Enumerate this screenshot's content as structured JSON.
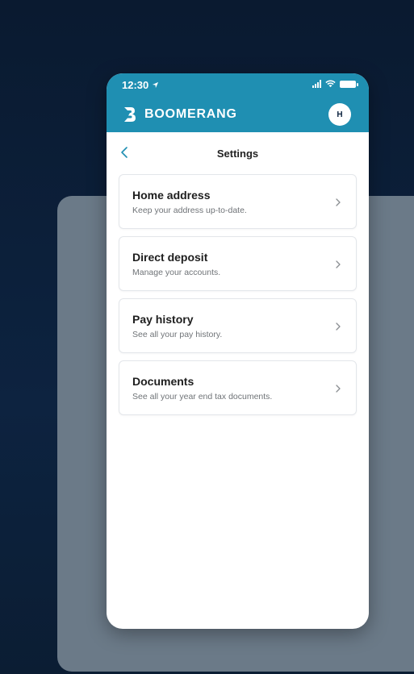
{
  "status": {
    "time": "12:30"
  },
  "appbar": {
    "brand": "BOOMERANG",
    "avatar_initial": "H"
  },
  "nav": {
    "title": "Settings"
  },
  "settings": [
    {
      "title": "Home address",
      "subtitle": "Keep your address up-to-date."
    },
    {
      "title": "Direct deposit",
      "subtitle": "Manage your accounts."
    },
    {
      "title": "Pay history",
      "subtitle": "See all your pay history."
    },
    {
      "title": "Documents",
      "subtitle": "See all your year end tax documents."
    }
  ],
  "colors": {
    "header": "#1f8fb2",
    "background": "#0d2340",
    "backdrop": "#6b7a88",
    "back_arrow": "#1f8fb2"
  },
  "icons": [
    "location-arrow-icon",
    "signal-icon",
    "wifi-icon",
    "battery-icon",
    "boomerang-logo-icon",
    "back-arrow-icon",
    "chevron-right-icon"
  ]
}
